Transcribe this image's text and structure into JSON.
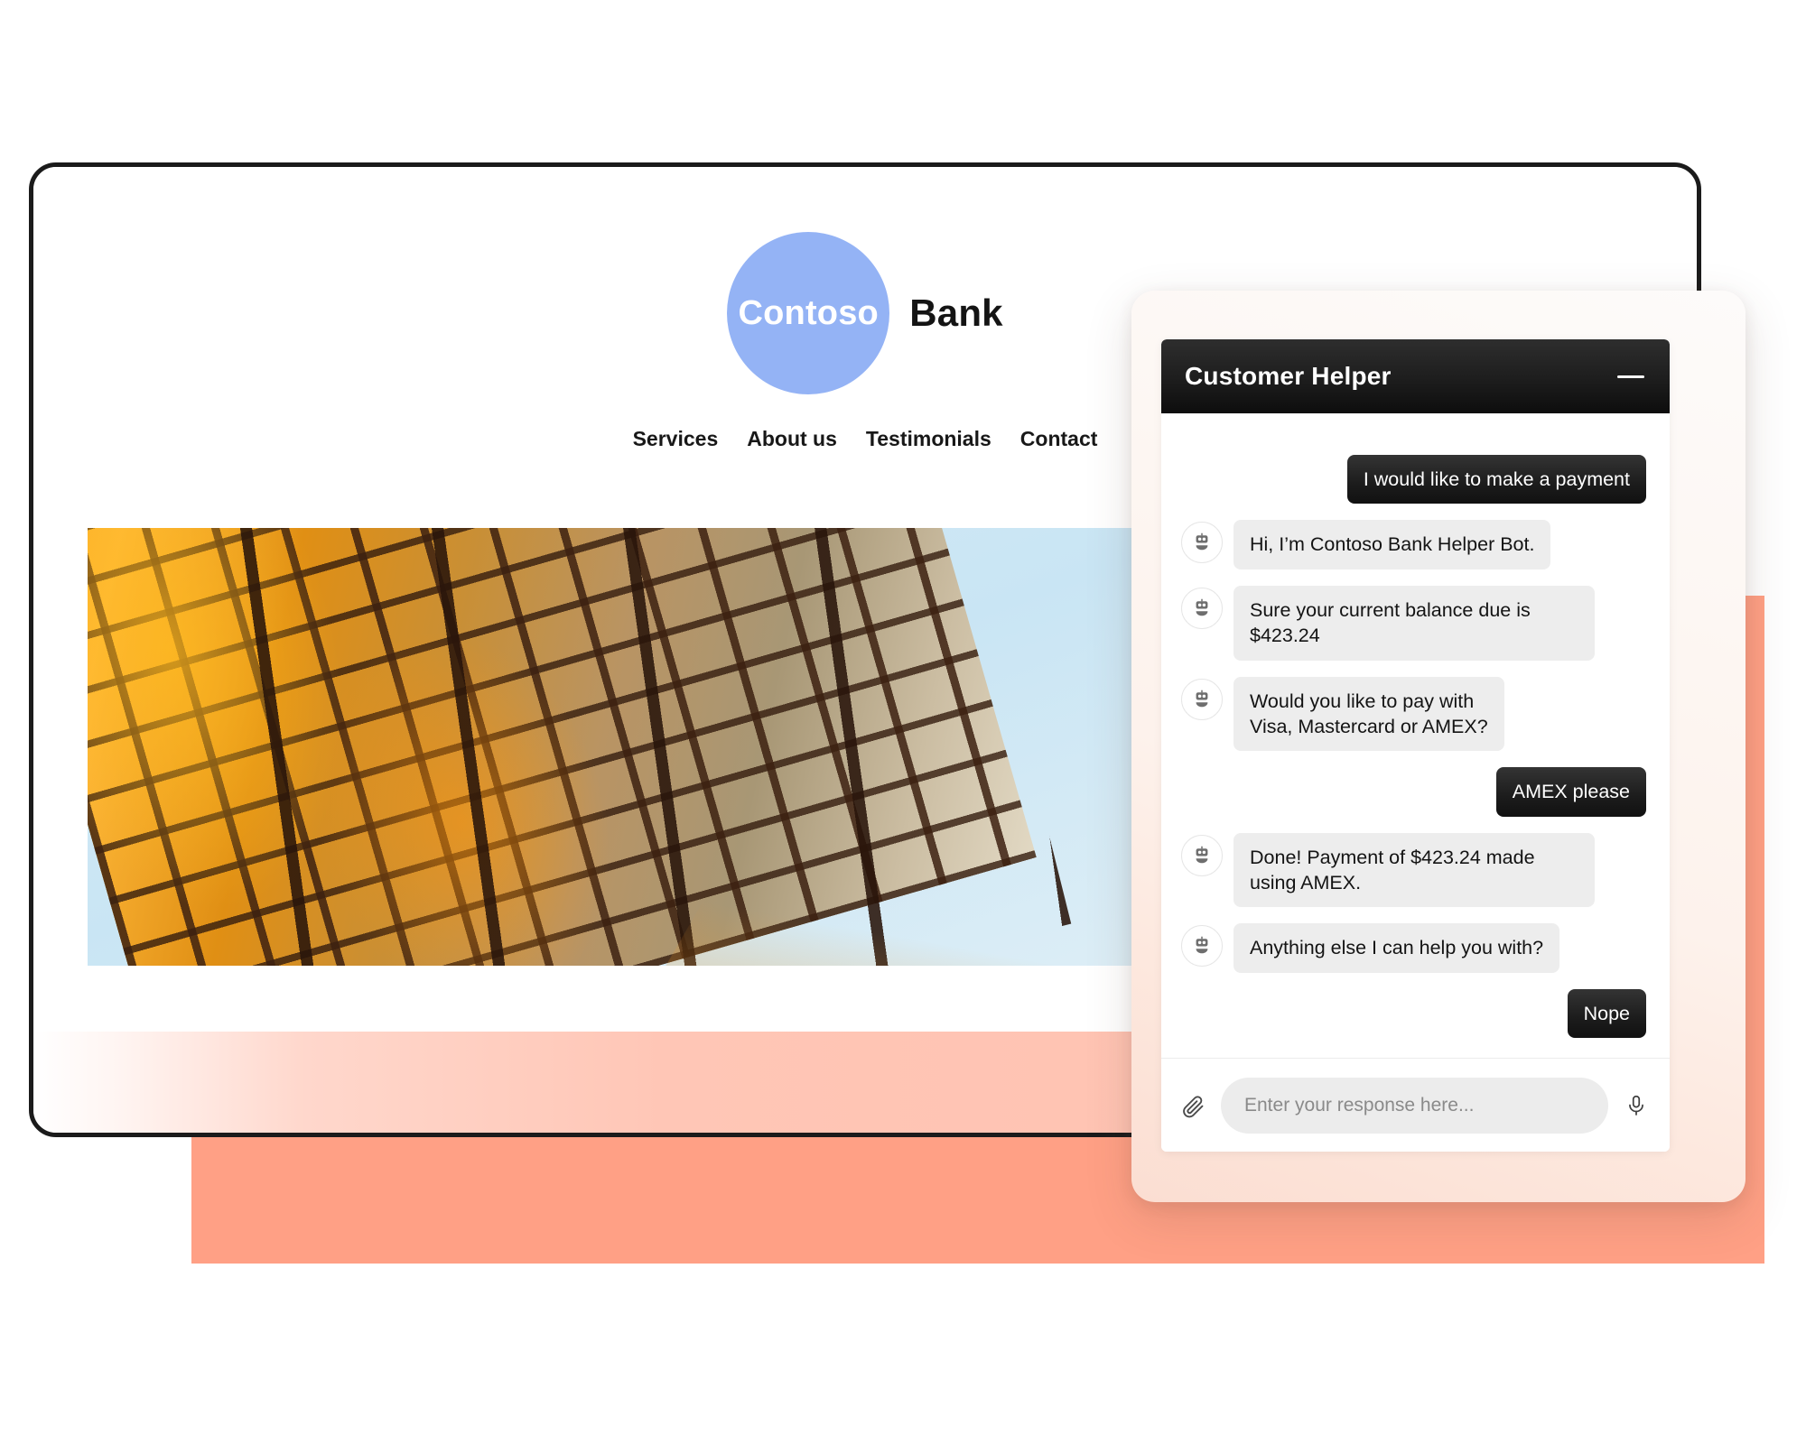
{
  "site": {
    "logo": {
      "badge_text": "Contoso",
      "word_text": "Bank"
    },
    "nav": [
      {
        "label": "Services"
      },
      {
        "label": "About us"
      },
      {
        "label": "Testimonials"
      },
      {
        "label": "Contact"
      }
    ],
    "hero_image_alt": "glass-skyscraper-facade-photo"
  },
  "chat": {
    "title": "Customer Helper",
    "minimize_label": "—",
    "messages": [
      {
        "sender": "user",
        "text": "I would like to make a payment"
      },
      {
        "sender": "bot",
        "text": "Hi, I’m Contoso Bank Helper Bot."
      },
      {
        "sender": "bot",
        "text": "Sure your current balance due is $423.24"
      },
      {
        "sender": "bot",
        "text": "Would you like to pay with Visa, Mastercard or AMEX?"
      },
      {
        "sender": "user",
        "text": "AMEX please"
      },
      {
        "sender": "bot",
        "text": "Done! Payment of $423.24 made using AMEX."
      },
      {
        "sender": "bot",
        "text": "Anything else I can help you with?"
      },
      {
        "sender": "user",
        "text": "Nope"
      }
    ],
    "input": {
      "value": "",
      "placeholder": "Enter your response here..."
    }
  },
  "colors": {
    "logo_badge": "#94b3f5",
    "coral_block": "#ffa085",
    "chat_header": "#1d1d1d",
    "user_bubble": "#1c1c1c",
    "bot_bubble": "#ededed"
  }
}
